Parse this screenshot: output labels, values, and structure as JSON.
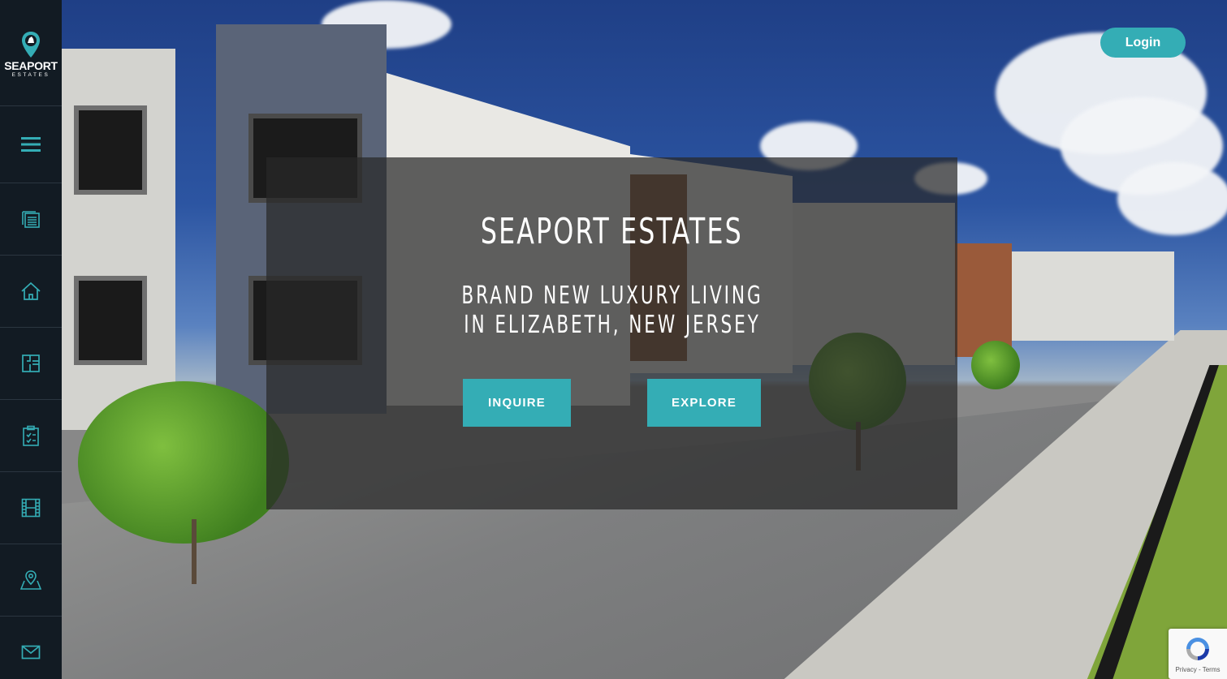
{
  "brand": {
    "logo_title": "SEAPORT",
    "logo_subtitle": "ESTATES"
  },
  "sidebar": {
    "items": [
      {
        "icon": "hamburger-menu-icon"
      },
      {
        "icon": "document-list-icon"
      },
      {
        "icon": "home-icon"
      },
      {
        "icon": "floor-plan-icon"
      },
      {
        "icon": "clipboard-checklist-icon"
      },
      {
        "icon": "film-icon"
      },
      {
        "icon": "map-location-icon"
      },
      {
        "icon": "envelope-icon"
      }
    ]
  },
  "header": {
    "login_label": "Login"
  },
  "hero": {
    "title": "SEAPORT ESTATES",
    "subtitle": "BRAND NEW LUXURY LIVING IN ELIZABETH, NEW JERSEY",
    "inquire_label": "INQUIRE",
    "explore_label": "EXPLORE"
  },
  "recaptcha": {
    "links": "Privacy - Terms"
  },
  "colors": {
    "accent": "#34adb5",
    "sidebar_bg": "#121b23"
  }
}
